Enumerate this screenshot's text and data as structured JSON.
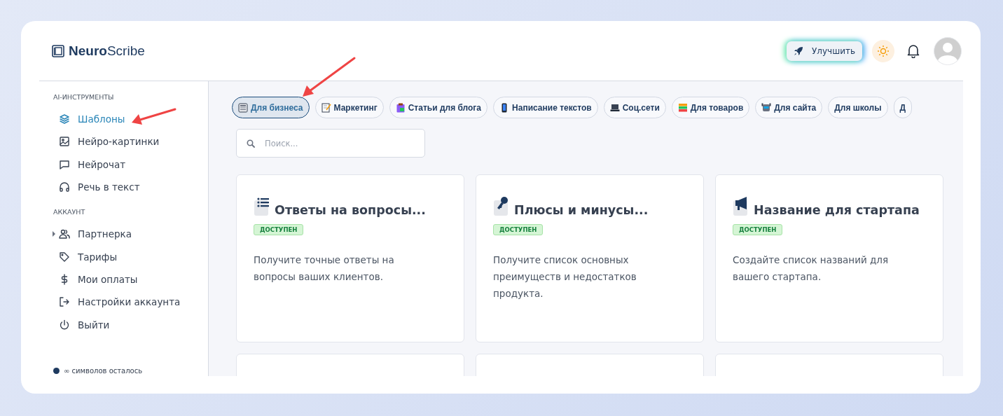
{
  "logo": {
    "bold": "Neuro",
    "rest": "Scribe"
  },
  "header": {
    "upgrade": "Улучшить"
  },
  "sidebar": {
    "sections": [
      {
        "title": "AI-ИНСТРУМЕНТЫ",
        "items": [
          {
            "label": "Шаблоны",
            "selected": true
          },
          {
            "label": "Нейро-картинки",
            "selected": false
          },
          {
            "label": "Нейрочат",
            "selected": false
          },
          {
            "label": "Речь в текст",
            "selected": false
          }
        ]
      },
      {
        "title": "АККАУНТ",
        "items": [
          {
            "label": "Партнерка",
            "selected": false,
            "expanded": false
          },
          {
            "label": "Тарифы",
            "selected": false
          },
          {
            "label": "Мои оплаты",
            "selected": false
          },
          {
            "label": "Настройки аккаунта",
            "selected": false
          },
          {
            "label": "Выйти",
            "selected": false
          }
        ]
      }
    ],
    "footer": "∞ символов осталось"
  },
  "categories": [
    {
      "label": "Для бизнеса",
      "selected": true
    },
    {
      "label": "Маркетинг",
      "selected": false
    },
    {
      "label": "Статьи для блога",
      "selected": false
    },
    {
      "label": "Написание текстов",
      "selected": false
    },
    {
      "label": "Соц.сети",
      "selected": false
    },
    {
      "label": "Для товаров",
      "selected": false
    },
    {
      "label": "Для сайта",
      "selected": false
    },
    {
      "label": "Для школы",
      "selected": false
    },
    {
      "label": "Д",
      "selected": false
    }
  ],
  "search": {
    "placeholder": "Поиск..."
  },
  "cards": [
    {
      "title": "Ответы на вопросы...",
      "badge": "ДОСТУПЕН",
      "description": "Получите точные ответы на вопросы ваших клиентов."
    },
    {
      "title": "Плюсы и минусы...",
      "badge": "ДОСТУПЕН",
      "description": "Получите список основных преимуществ и недостатков продукта."
    },
    {
      "title": "Название для стартапа",
      "badge": "ДОСТУПЕН",
      "description": "Создайте список названий для вашего стартапа."
    }
  ]
}
